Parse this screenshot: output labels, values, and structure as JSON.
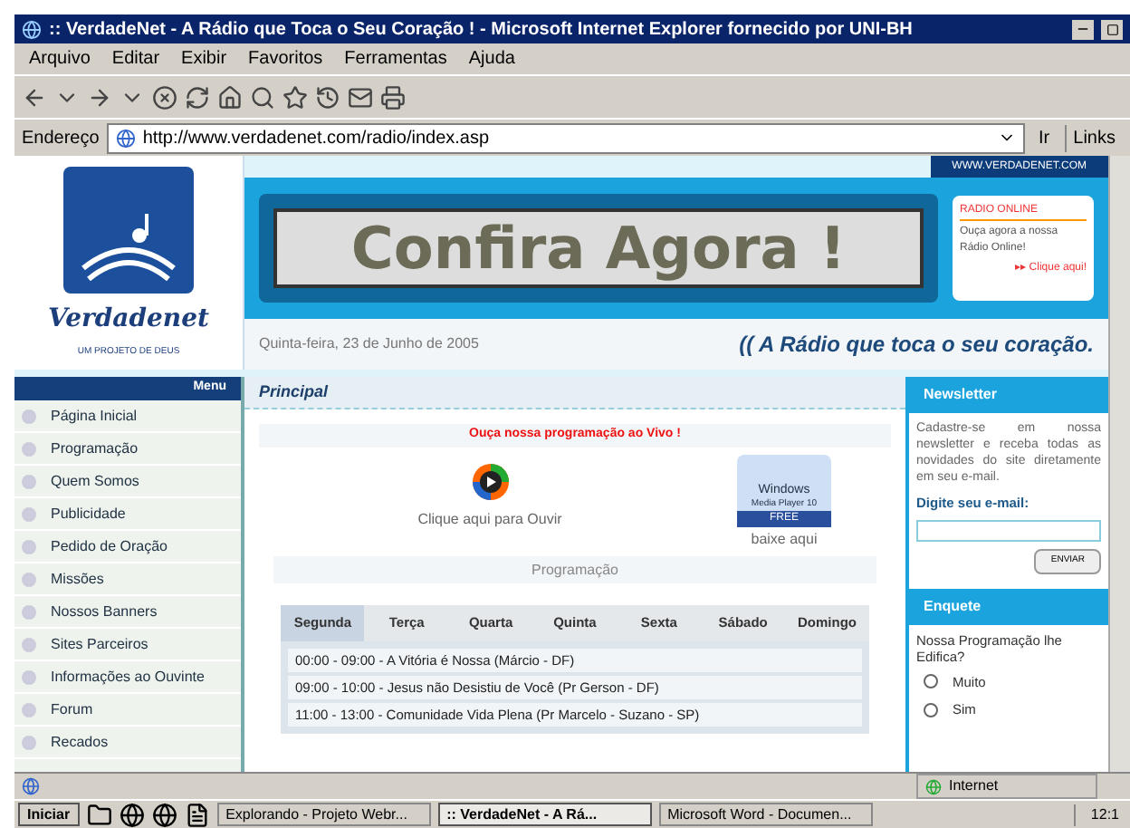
{
  "window": {
    "title": ":: VerdadeNet - A Rádio que Toca o Seu Coração ! - Microsoft Internet Explorer fornecido por UNI-BH"
  },
  "menu_bar": [
    "Arquivo",
    "Editar",
    "Exibir",
    "Favoritos",
    "Ferramentas",
    "Ajuda"
  ],
  "address_bar": {
    "label": "Endereço",
    "url": "http://www.verdadenet.com/radio/index.asp",
    "go": "Ir",
    "links": "Links"
  },
  "header": {
    "site_url": "WWW.VERDADENET.COM",
    "logo_name": "Verdadenet",
    "logo_tagline": "UM PROJETO DE DEUS",
    "banner": "Confira Agora !",
    "radio_online": {
      "title": "RADIO ONLINE",
      "text": "Ouça agora a nossa Rádio Online!",
      "link": "▸▸ Clique aqui!"
    },
    "date": "Quinta-feira, 23 de Junho de 2005",
    "slogan": "(( A Rádio que toca o seu coração."
  },
  "sidebar": {
    "title": "Menu",
    "items": [
      "Página Inicial",
      "Programação",
      "Quem Somos",
      "Publicidade",
      "Pedido de Oração",
      "Missões",
      "Nossos Banners",
      "Sites Parceiros",
      "Informações ao Ouvinte",
      "Forum",
      "Recados"
    ]
  },
  "main": {
    "title": "Principal",
    "live": "Ouça nossa programação ao Vivo !",
    "listen": "Clique aqui para Ouvir",
    "player_badge": {
      "brand": "Windows",
      "product": "Media Player 10",
      "tag": "FREE"
    },
    "download": "baixe aqui",
    "schedule_title": "Programação",
    "days": [
      {
        "label": "Segunda",
        "selected": true
      },
      {
        "label": "Terça",
        "selected": false
      },
      {
        "label": "Quarta",
        "selected": false
      },
      {
        "label": "Quinta",
        "selected": false
      },
      {
        "label": "Sexta",
        "selected": false
      },
      {
        "label": "Sábado",
        "selected": false
      },
      {
        "label": "Domingo",
        "selected": false
      }
    ],
    "schedule": [
      "00:00 - 09:00 - A Vitória é Nossa (Márcio - DF)",
      "09:00 - 10:00 - Jesus não Desistiu de Você (Pr Gerson - DF)",
      "11:00 - 13:00 - Comunidade Vida Plena (Pr Marcelo - Suzano - SP)"
    ]
  },
  "newsletter": {
    "title": "Newsletter",
    "text": "Cadastre-se em nossa newsletter e receba todas as novidades do site diretamente em seu e-mail.",
    "email_label": "Digite seu e-mail:",
    "button": "ENVIAR"
  },
  "poll": {
    "title": "Enquete",
    "question": "Nossa Programação lhe Edifica?",
    "options": [
      {
        "label": "Muito",
        "selected": false
      },
      {
        "label": "Sim",
        "selected": false
      }
    ]
  },
  "status_bar": {
    "zone": "Internet"
  },
  "taskbar": {
    "start": "Iniciar",
    "tasks": [
      {
        "label": "Explorando - Projeto Webr...",
        "selected": false
      },
      {
        "label": ":: VerdadeNet - A Rá...",
        "selected": true
      },
      {
        "label": "Microsoft Word - Documen...",
        "selected": false
      }
    ],
    "clock": "12:1"
  }
}
